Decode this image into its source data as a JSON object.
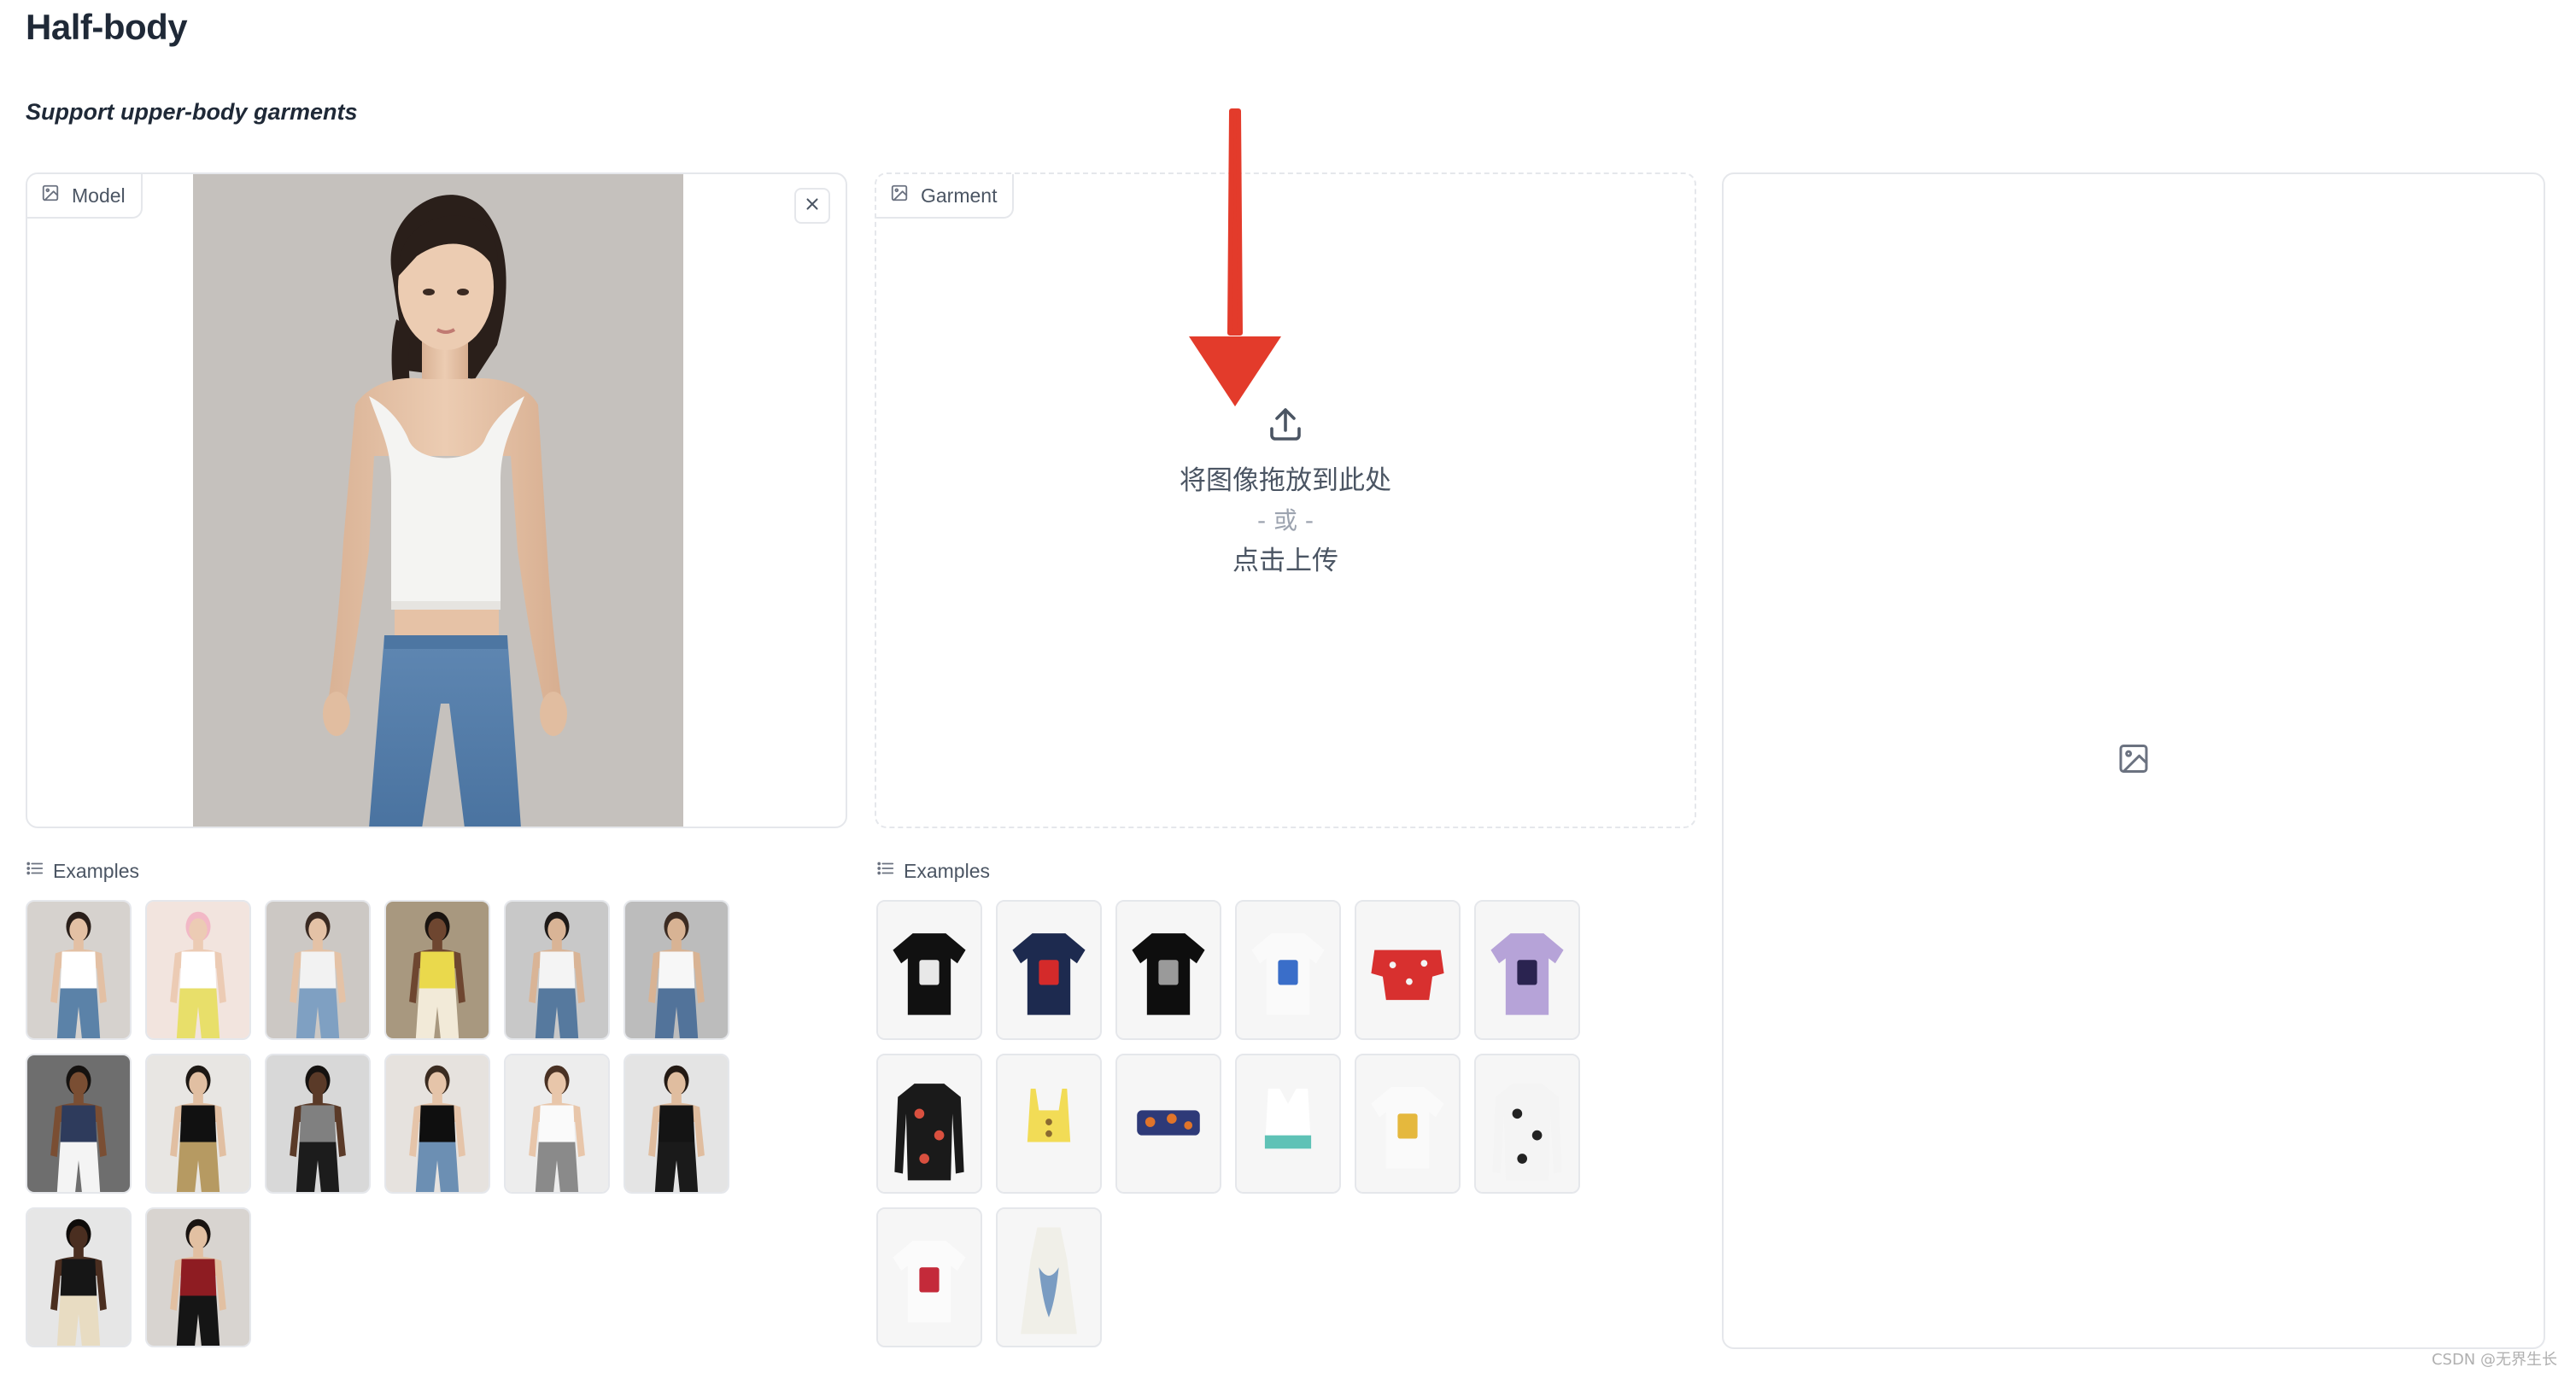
{
  "page": {
    "title": "Half-body",
    "subtitle": "Support upper-body garments"
  },
  "model_panel": {
    "label": "Model",
    "label_icon": "image-icon",
    "close_icon": "close-icon"
  },
  "garment_panel": {
    "label": "Garment",
    "label_icon": "image-icon",
    "upload_icon": "upload-icon",
    "drop_text": "将图像拖放到此处",
    "or_text": "- 或 -",
    "click_text": "点击上传"
  },
  "output_panel": {
    "placeholder_icon": "image-icon"
  },
  "model_examples": {
    "label": "Examples",
    "icon": "list-icon",
    "items": [
      {
        "top": "#ffffff",
        "bottom": "#5b82a8",
        "skin": "#e3c0a4",
        "hair": "#2a1f1a",
        "bg": "#d6d2ce"
      },
      {
        "top": "#ffffff",
        "bottom": "#e8df6a",
        "skin": "#eccbb4",
        "hair": "#f2b8c6",
        "bg": "#f2e4de"
      },
      {
        "top": "#f2f2f2",
        "bottom": "#7fa0c2",
        "skin": "#e4c2a6",
        "hair": "#3a2a22",
        "bg": "#ccc8c4"
      },
      {
        "top": "#ead94c",
        "bottom": "#f2ead8",
        "skin": "#6e4630",
        "hair": "#1a1410",
        "bg": "#a8987f"
      },
      {
        "top": "#f4f4f4",
        "bottom": "#56799e",
        "skin": "#d9b496",
        "hair": "#1e1a18",
        "bg": "#c8c8c8"
      },
      {
        "top": "#f7f7f7",
        "bottom": "#52739a",
        "skin": "#d8b394",
        "hair": "#3b2b22",
        "bg": "#bcbcbc"
      },
      {
        "top": "#2e3b5c",
        "bottom": "#f4f4f4",
        "skin": "#7a4e33",
        "hair": "#151210",
        "bg": "#6e6e6e"
      },
      {
        "top": "#111111",
        "bottom": "#b69a62",
        "skin": "#e1bfa2",
        "hair": "#1d1814",
        "bg": "#e8e6e3"
      },
      {
        "top": "#808080",
        "bottom": "#1c1c1c",
        "skin": "#5a3a28",
        "hair": "#151210",
        "bg": "#d8d8d8"
      },
      {
        "top": "#0f0f0f",
        "bottom": "#6c8fb3",
        "skin": "#e5c4a9",
        "hair": "#3a2b20",
        "bg": "#e6e2de"
      },
      {
        "top": "#fafafa",
        "bottom": "#8a8a8a",
        "skin": "#e8c6aa",
        "hair": "#4a3224",
        "bg": "#ededed"
      },
      {
        "top": "#141414",
        "bottom": "#1a1a1a",
        "skin": "#e0bd9f",
        "hair": "#241a14",
        "bg": "#e4e4e4"
      },
      {
        "top": "#161616",
        "bottom": "#e8dcc2",
        "skin": "#4a2e20",
        "hair": "#0f0c0a",
        "bg": "#e6e6e6"
      },
      {
        "top": "#8e1c22",
        "bottom": "#151515",
        "skin": "#e2c0a2",
        "hair": "#1a1411",
        "bg": "#d8d4d0"
      }
    ]
  },
  "garment_examples": {
    "label": "Examples",
    "icon": "list-icon",
    "items": [
      {
        "kind": "tshirt",
        "main": "#111111",
        "accent": "#e8e8e8"
      },
      {
        "kind": "tshirt",
        "main": "#1d2a4f",
        "accent": "#d42a2a"
      },
      {
        "kind": "tshirt",
        "main": "#0e0e0e",
        "accent": "#9a9a9a"
      },
      {
        "kind": "tshirt",
        "main": "#fafafa",
        "accent": "#3a6ec9"
      },
      {
        "kind": "offshoulder",
        "main": "#d8302f",
        "accent": "#f3f3f3"
      },
      {
        "kind": "tshirt",
        "main": "#b6a3d8",
        "accent": "#2a2350"
      },
      {
        "kind": "longsleeve",
        "main": "#1a1a1a",
        "accent": "#d9503f"
      },
      {
        "kind": "crop",
        "main": "#f2dc56",
        "accent": "#8a6a30"
      },
      {
        "kind": "bandeau",
        "main": "#2e3a78",
        "accent": "#e0742a"
      },
      {
        "kind": "sportsbra",
        "main": "#ffffff",
        "accent": "#5fc2b6"
      },
      {
        "kind": "tshirt",
        "main": "#fafafa",
        "accent": "#e5b83d"
      },
      {
        "kind": "longsleeve",
        "main": "#f4f4f4",
        "accent": "#222222"
      },
      {
        "kind": "tshirt",
        "main": "#fbfbfb",
        "accent": "#c42a3a"
      },
      {
        "kind": "dress",
        "main": "#f0efe8",
        "accent": "#7a9cc2"
      }
    ]
  },
  "watermark": "CSDN @无界生长"
}
